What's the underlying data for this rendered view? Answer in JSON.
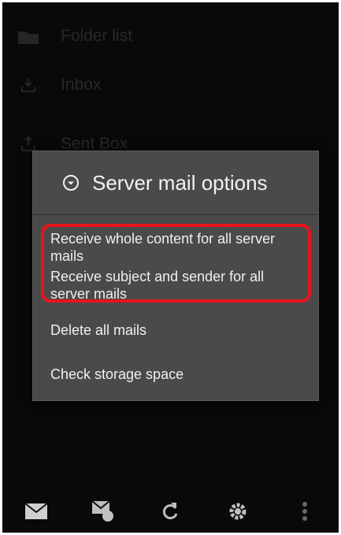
{
  "background": {
    "rows": [
      {
        "label": "Folder list",
        "icon": "folder-icon"
      },
      {
        "label": "Inbox",
        "icon": "inbox-tray-icon"
      },
      {
        "label": "Sent Box",
        "icon": "sent-tray-icon"
      }
    ]
  },
  "dialog": {
    "title": "Server mail options",
    "title_icon": "radio-dot-icon",
    "options": [
      {
        "label": "Receive whole content for all server mails"
      },
      {
        "label": "Receive subject and sender for all server mails"
      },
      {
        "label": "Delete all mails"
      },
      {
        "label": "Check storage space"
      }
    ]
  },
  "bottom_bar": {
    "icons": [
      "mail-icon",
      "mail-settings-icon",
      "refresh-icon",
      "gear-icon",
      "more-vertical-icon"
    ]
  },
  "colors": {
    "highlight": "#e8141b",
    "dialog_bg": "#4a4a4a",
    "screen_bg": "#0e0e0e"
  }
}
